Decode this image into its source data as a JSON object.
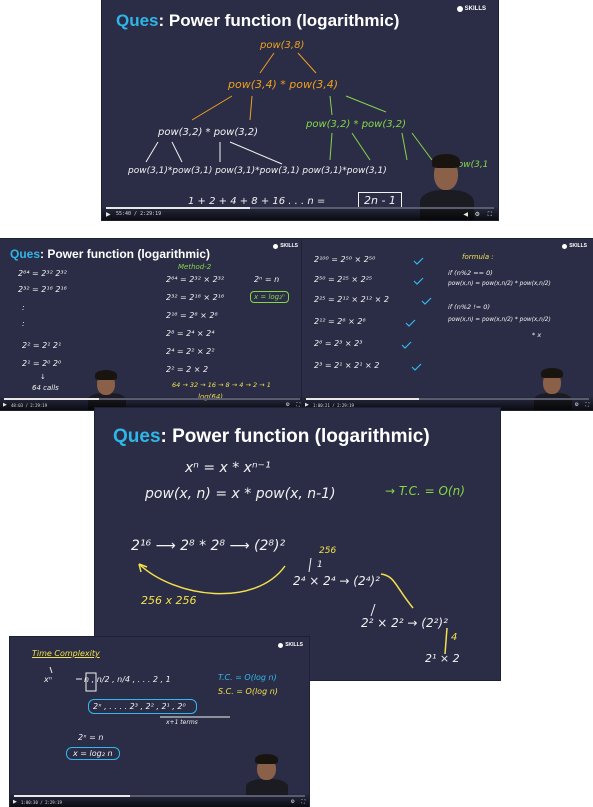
{
  "frame1": {
    "ques": "Ques",
    "title": ": Power function (logarithmic)",
    "logo": "SKILLS",
    "root": "pow(3,8)",
    "level2": "pow(3,4) * pow(3,4)",
    "level3_left": "pow(3,2) * pow(3,2)",
    "level3_right": "pow(3,2) * pow(3,2)",
    "level4": "pow(3,1)*pow(3,1)  pow(3,1)*pow(3,1)  pow(3,1)*pow(3,1)",
    "level4_tail": "pow(3,1",
    "sum": "1 + 2 + 4 + 8 + 16 . . .   n   =",
    "boxed": "2n - 1",
    "time": "55:40 / 2:29:19"
  },
  "frame2": {
    "ques": "Ques",
    "title": ": Power function (logarithmic)",
    "logo": "SKILLS",
    "left_lines": [
      "2⁶⁴  =  2³²  2³²",
      "2³²  =  2¹⁶ 2¹⁶",
      ":",
      ":",
      "2²  =  2¹ 2¹",
      "2¹  =  2⁰ 2⁰",
      "↓",
      "64 calls"
    ],
    "method": "Method-2",
    "mid_lines": [
      "2⁶⁴  =  2³² × 2³²",
      "2³²  =  2¹⁶ × 2¹⁶",
      "2¹⁶  =  2⁸ × 2⁸",
      "2⁸  =  2⁴ × 2⁴",
      "2⁴  =  2² × 2²",
      "2²  =  2 × 2"
    ],
    "sum_line": "64 → 32 → 16 → 8 → 4 → 2 → 1",
    "log_line": "log(64)",
    "right_a": "2ⁿ = n",
    "right_b": "x = log₂ⁿ",
    "time": "48:03 / 2:29:19"
  },
  "frame3": {
    "logo": "SKILLS",
    "left_lines": [
      "2¹⁰⁰  =  2⁵⁰ × 2⁵⁰",
      "2⁵⁰  =  2²⁵ × 2²⁵",
      "2²⁵  =  2¹² × 2¹² × 2",
      "2¹²  =  2⁶ × 2⁶",
      "2⁶  =  2³ × 2³",
      "2³  =  2¹ × 2¹ × 2"
    ],
    "formula_title": "formula :",
    "formula_lines": [
      "if (n%2 == 0)",
      "pow(x,n) = pow(x,n/2) * pow(x,n/2)",
      "if (n%2 != 0)",
      "pow(x,n) = pow(x,n/2) * pow(x,n/2)",
      "* x"
    ],
    "time": "1:00:21 / 2:29:19"
  },
  "frame4": {
    "ques": "Ques",
    "title": ": Power function (logarithmic)",
    "line1": "xⁿ  =  x * xⁿ⁻¹",
    "line2": "pow(x, n)  =  x * pow(x, n-1)",
    "tc": "→ T.C. = O(n)",
    "chain_a": "2¹⁶  ⟶  2⁸ * 2⁸  ⟶  (2⁸)²",
    "n256": "256",
    "mul256": "256 x 256",
    "chain_b": "2⁴ × 2⁴  → (2⁴)²",
    "chain_c": "2² × 2²  → (2²)²",
    "chain_d": "2¹ × 2",
    "one": "1",
    "four": "4"
  },
  "frame5": {
    "logo": "SKILLS",
    "heading": "Time Complexity",
    "row1": "n ,  n/2 ,  n/4 , . . . 2 , 1",
    "row2": "2ˣ , . . . . 2³ , 2² , 2¹ , 2⁰",
    "terms": "x+1 terms",
    "tc": "T.C. = O(log n)",
    "sc": "S.C. = O(log n)",
    "eq1": "2ˣ = n",
    "eq2": "x = log₂ n",
    "xn": "xⁿ",
    "time": "1:00:30 / 2:29:19"
  },
  "progress": {
    "frame1": 0.37,
    "frame2": 0.32,
    "frame3": 0.4,
    "frame5": 0.4
  }
}
